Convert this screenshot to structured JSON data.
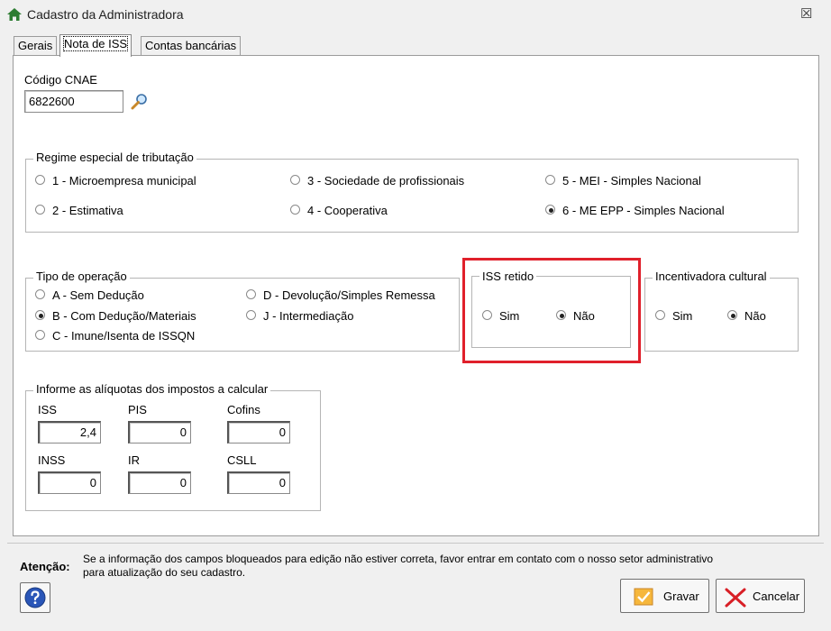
{
  "window": {
    "title": "Cadastro da Administradora",
    "close_glyph": "☒"
  },
  "tabs": [
    {
      "label": "Gerais",
      "active": false
    },
    {
      "label": "Nota de ISS",
      "active": true
    },
    {
      "label": "Contas bancárias",
      "active": false
    }
  ],
  "cnae": {
    "label": "Código CNAE",
    "value": "6822600"
  },
  "regime": {
    "title": "Regime especial de tributação",
    "options": [
      {
        "label": "1 - Microempresa municipal",
        "selected": false
      },
      {
        "label": "2 - Estimativa",
        "selected": false
      },
      {
        "label": "3 - Sociedade de profissionais",
        "selected": false
      },
      {
        "label": "4 - Cooperativa",
        "selected": false
      },
      {
        "label": "5 - MEI - Simples Nacional",
        "selected": false
      },
      {
        "label": "6 - ME EPP - Simples Nacional",
        "selected": true
      }
    ]
  },
  "operacao": {
    "title": "Tipo de operação",
    "options": [
      {
        "label": "A - Sem Dedução",
        "selected": false
      },
      {
        "label": "B - Com Dedução/Materiais",
        "selected": true
      },
      {
        "label": "C - Imune/Isenta de ISSQN",
        "selected": false
      },
      {
        "label": "D - Devolução/Simples Remessa",
        "selected": false
      },
      {
        "label": "J - Intermediação",
        "selected": false
      }
    ]
  },
  "iss_retido": {
    "title": "ISS retido",
    "options": [
      {
        "label": "Sim",
        "selected": false
      },
      {
        "label": "Não",
        "selected": true
      }
    ]
  },
  "incentivadora": {
    "title": "Incentivadora cultural",
    "options": [
      {
        "label": "Sim",
        "selected": false
      },
      {
        "label": "Não",
        "selected": true
      }
    ]
  },
  "aliquotas": {
    "title": "Informe as alíquotas dos impostos a calcular",
    "fields": [
      {
        "label": "ISS",
        "value": "2,4"
      },
      {
        "label": "PIS",
        "value": "0"
      },
      {
        "label": "Cofins",
        "value": "0"
      },
      {
        "label": "INSS",
        "value": "0"
      },
      {
        "label": "IR",
        "value": "0"
      },
      {
        "label": "CSLL",
        "value": "0"
      }
    ]
  },
  "footer": {
    "attention_label": "Atenção:",
    "message_line1": "Se a informação dos campos bloqueados para edição não estiver correta, favor entrar em contato com o nosso setor administrativo",
    "message_line2": "para atualização do seu cadastro.",
    "save_label": "Gravar",
    "cancel_label": "Cancelar"
  },
  "colors": {
    "highlight": "#e0202b",
    "house": "#2e7d32",
    "help": "#2a56b8"
  },
  "icons": {
    "window": "house-icon",
    "search": "magnifier-icon",
    "help": "question-icon",
    "save": "check-icon",
    "cancel": "x-icon"
  }
}
